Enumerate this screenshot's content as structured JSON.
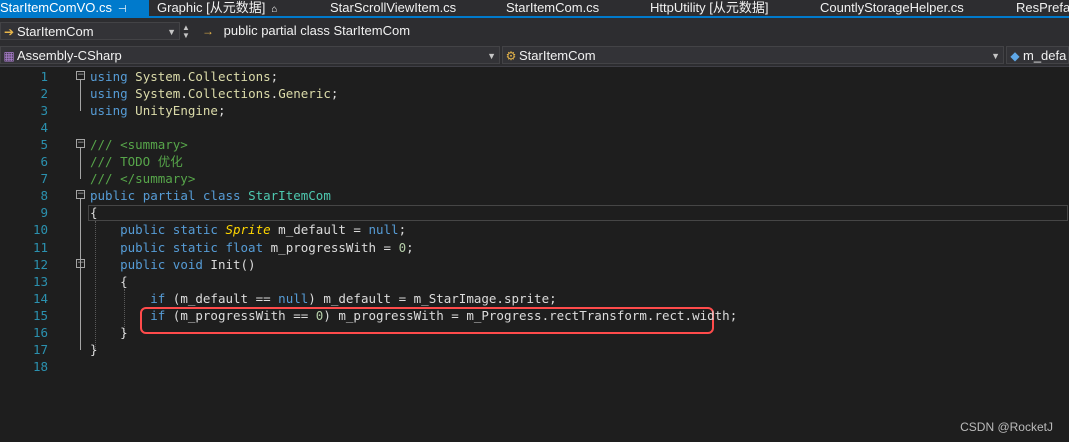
{
  "tabs": [
    {
      "label": "StarItemComVO.cs",
      "active": true,
      "pin": "⊣"
    },
    {
      "label": "Graphic [从元数据]",
      "lock": "🔒"
    },
    {
      "label": "StarScrollViewItem.cs"
    },
    {
      "label": "StarItemCom.cs"
    },
    {
      "label": "HttpUtility [从元数据]"
    },
    {
      "label": "CountlyStorageHelper.cs"
    },
    {
      "label": "ResPrefab"
    }
  ],
  "navbar": {
    "file_dropdown": "StarItemCom",
    "breadcrumb_icon": "→",
    "breadcrumb": "public partial class StarItemCom",
    "project": "Assembly-CSharp",
    "class_dropdown": "StarItemCom",
    "member_dropdown": "m_defa"
  },
  "colors": {
    "accent": "#007acc",
    "highlight_box": "#ff4b4b",
    "keyword": "#569cd6",
    "type": "#4ec9b0",
    "comment": "#57a64a",
    "line_number": "#2b91af"
  },
  "editor": {
    "lines": [
      {
        "n": "1",
        "fold": "−",
        "tokens": [
          [
            "kw",
            "using"
          ],
          [
            "pl",
            " "
          ],
          [
            "ns",
            "System"
          ],
          [
            "pl",
            "."
          ],
          [
            "ns",
            "Collections"
          ],
          [
            "pl",
            ";"
          ]
        ]
      },
      {
        "n": "2",
        "tokens": [
          [
            "kw",
            "using"
          ],
          [
            "pl",
            " "
          ],
          [
            "ns",
            "System"
          ],
          [
            "pl",
            "."
          ],
          [
            "ns",
            "Collections"
          ],
          [
            "pl",
            "."
          ],
          [
            "ns",
            "Generic"
          ],
          [
            "pl",
            ";"
          ]
        ]
      },
      {
        "n": "3",
        "tokens": [
          [
            "kw",
            "using"
          ],
          [
            "pl",
            " "
          ],
          [
            "ns",
            "UnityEngine"
          ],
          [
            "pl",
            ";"
          ]
        ]
      },
      {
        "n": "4",
        "tokens": []
      },
      {
        "n": "5",
        "fold": "−",
        "tokens": [
          [
            "cm",
            "/// <summary>"
          ]
        ]
      },
      {
        "n": "6",
        "tokens": [
          [
            "cm",
            "/// TODO 优化"
          ]
        ]
      },
      {
        "n": "7",
        "tokens": [
          [
            "cm",
            "/// </summary>"
          ]
        ]
      },
      {
        "n": "8",
        "fold": "−",
        "tokens": [
          [
            "kw",
            "public"
          ],
          [
            "pl",
            " "
          ],
          [
            "kw",
            "partial"
          ],
          [
            "pl",
            " "
          ],
          [
            "kw",
            "class"
          ],
          [
            "pl",
            " "
          ],
          [
            "type",
            "StarItemCom"
          ]
        ]
      },
      {
        "n": "9",
        "tokens": [
          [
            "pl",
            "{"
          ]
        ]
      },
      {
        "n": "10",
        "tokens": [
          [
            "pl",
            "    "
          ],
          [
            "kw",
            "public"
          ],
          [
            "pl",
            " "
          ],
          [
            "kw",
            "static"
          ],
          [
            "pl",
            " "
          ],
          [
            "sp",
            "Sprite"
          ],
          [
            "pl",
            " m_default = "
          ],
          [
            "kw",
            "null"
          ],
          [
            "pl",
            ";"
          ]
        ]
      },
      {
        "n": "11",
        "tokens": [
          [
            "pl",
            "    "
          ],
          [
            "kw",
            "public"
          ],
          [
            "pl",
            " "
          ],
          [
            "kw",
            "static"
          ],
          [
            "pl",
            " "
          ],
          [
            "kw",
            "float"
          ],
          [
            "pl",
            " m_progressWith = "
          ],
          [
            "num",
            "0"
          ],
          [
            "pl",
            ";"
          ]
        ]
      },
      {
        "n": "12",
        "fold": "−",
        "tokens": [
          [
            "pl",
            "    "
          ],
          [
            "kw",
            "public"
          ],
          [
            "pl",
            " "
          ],
          [
            "kw",
            "void"
          ],
          [
            "pl",
            " Init()"
          ]
        ]
      },
      {
        "n": "13",
        "tokens": [
          [
            "pl",
            "    {"
          ]
        ]
      },
      {
        "n": "14",
        "tokens": [
          [
            "pl",
            "        "
          ],
          [
            "kw",
            "if"
          ],
          [
            "pl",
            " (m_default == "
          ],
          [
            "kw",
            "null"
          ],
          [
            "pl",
            ") m_default = m_StarImage.sprite;"
          ]
        ]
      },
      {
        "n": "15",
        "tokens": [
          [
            "pl",
            "        "
          ],
          [
            "kw",
            "if"
          ],
          [
            "pl",
            " (m_progressWith == "
          ],
          [
            "num",
            "0"
          ],
          [
            "pl",
            ") m_progressWith = m_Progress.rectTransform.rect.width;"
          ]
        ]
      },
      {
        "n": "16",
        "tokens": [
          [
            "pl",
            "    }"
          ]
        ]
      },
      {
        "n": "17",
        "tokens": [
          [
            "pl",
            "}"
          ]
        ]
      },
      {
        "n": "18",
        "tokens": []
      }
    ]
  },
  "watermark": "CSDN @RocketJ"
}
